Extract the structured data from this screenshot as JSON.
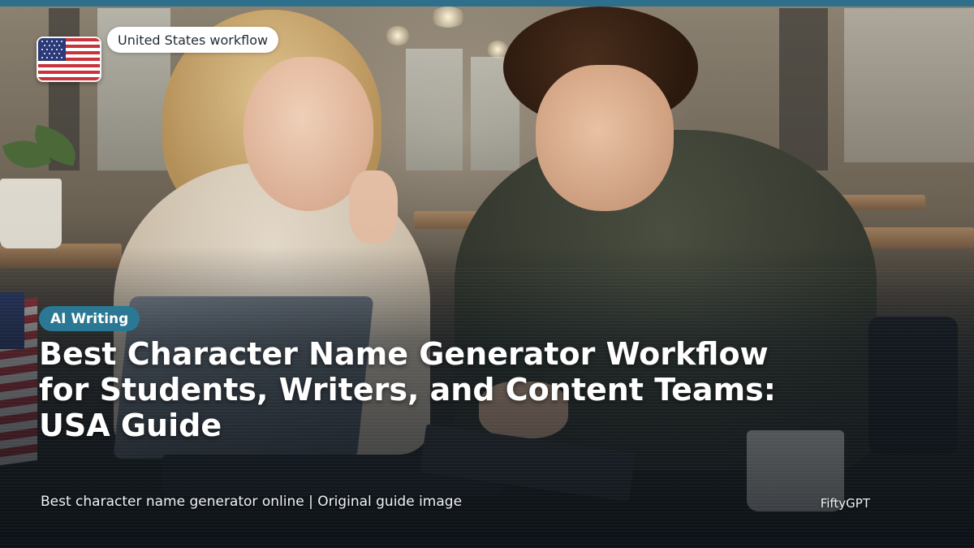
{
  "header": {
    "flag_icon": "us-flag-icon",
    "region_label": "United States workflow"
  },
  "article": {
    "category": "AI Writing",
    "title_lines": [
      "Best Character Name Generator Workflow",
      "for Students, Writers, and Content Teams:",
      "USA Guide"
    ]
  },
  "footer": {
    "caption": "Best character name generator online | Original guide image",
    "brand": "FiftyGPT"
  },
  "colors": {
    "accent_bar": "#2e6f8c",
    "category_pill": "#2a7893",
    "region_pill_bg": "#ffffff",
    "text_light": "#ffffff"
  }
}
